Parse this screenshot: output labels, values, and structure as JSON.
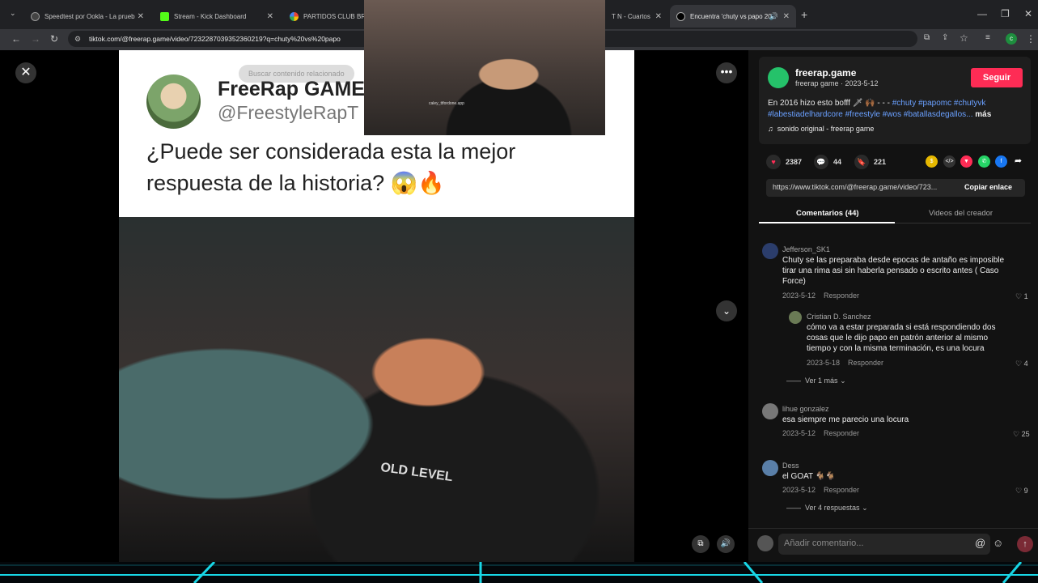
{
  "browser": {
    "tabs": [
      {
        "title": "Speedtest por Ookla - La prueb",
        "color": "#444"
      },
      {
        "title": "Stream - Kick Dashboard",
        "color": "#53fc18"
      },
      {
        "title": "PARTIDOS CLUB BRUJ",
        "color": "#4285f4"
      },
      {
        "title": "T N - Cuartos",
        "color": "#777"
      },
      {
        "title": "Encuentra 'chuty vs papo 20",
        "color": "#fff"
      }
    ],
    "url": "tiktok.com/@freerap.game/video/7232287039352360219?q=chuty%20vs%20papo",
    "profile_letter": "c"
  },
  "video": {
    "search_related": "Buscar contenido relacionado",
    "tweet": {
      "name": "FreeRap GAME",
      "handle": "@FreestyleRapT",
      "text": "¿Puede ser considerada esta la mejor respuesta de la historia? 😱🔥"
    },
    "shirt_text": "OLD LEVEL",
    "webcam_caption": "caley_ttfordone.app"
  },
  "creator": {
    "username": "freerap.game",
    "subline": "freerap game · 2023-5-12",
    "follow_label": "Seguir",
    "desc_plain": "En 2016 hizo esto bofff 🗡 🙌🏾 - - - ",
    "desc_tags": "#chuty #papomc #chutyvk #labestiadelhardcore #freestyle #wos #batallasdegallos...",
    "desc_more": "más",
    "sound": "sonido original - freerap game"
  },
  "stats": {
    "likes": "2387",
    "comments": "44",
    "saves": "221"
  },
  "link": {
    "url": "https://www.tiktok.com/@freerap.game/video/723...",
    "copy_label": "Copiar enlace"
  },
  "tabs": {
    "comments": "Comentarios (44)",
    "creator_videos": "Videos del creador"
  },
  "comments": [
    {
      "user": "Jefferson_SK1",
      "text": "Chuty se las preparaba desde epocas de antaño es imposible tirar una rima asi sin haberla pensado o escrito antes ( Caso Force)",
      "date": "2023-5-12",
      "reply": "Responder",
      "likes": "1"
    },
    {
      "user": "Cristian D. Sanchez",
      "text": "cómo va a estar preparada si está respondiendo dos cosas que le dijo papo en patrón anterior al mismo tiempo y con la misma terminación, es una locura",
      "date": "2023-5-18",
      "reply": "Responder",
      "likes": "4"
    },
    {
      "user": "lihue gonzalez",
      "text": "esa siempre me parecio una locura",
      "date": "2023-5-12",
      "reply": "Responder",
      "likes": "25"
    },
    {
      "user": "Dess",
      "text": "el GOAT 🐐🐐",
      "date": "2023-5-12",
      "reply": "Responder",
      "likes": "9"
    }
  ],
  "more_replies_1": "Ver 1 más",
  "more_replies_2": "Ver 4 respuestas",
  "comment_placeholder": "Añadir comentario...",
  "colors": {
    "brand": "#fe2c55",
    "tag": "#6aa0ff",
    "panel": "#121212"
  }
}
